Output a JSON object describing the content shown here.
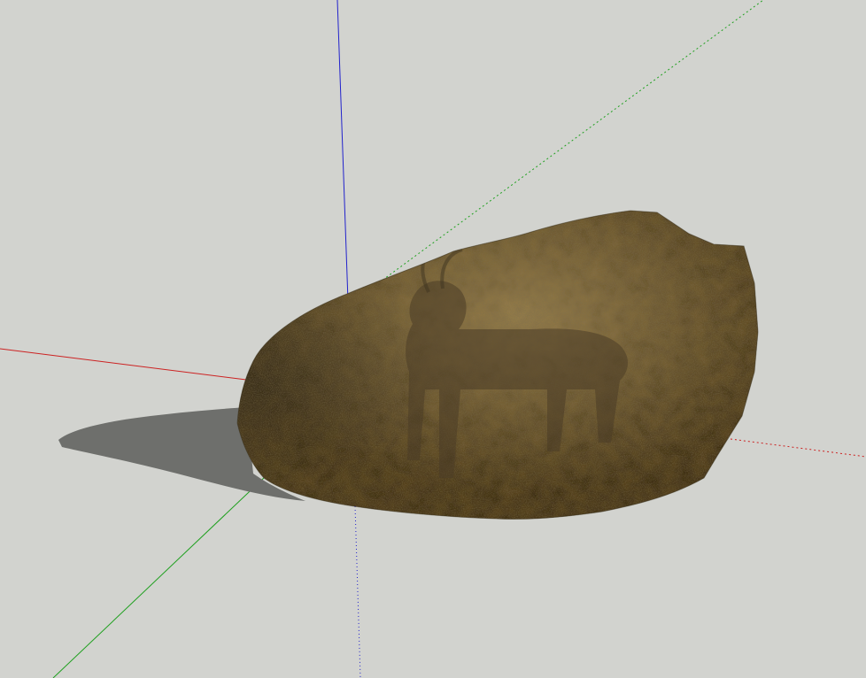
{
  "viewport": {
    "background": "#d2d3cf"
  },
  "axes": {
    "red_axis_color": "#cc2222",
    "green_axis_color": "#1fa01f",
    "blue_axis_color": "#2222cc"
  },
  "model": {
    "icon": "rock-boulder",
    "texture_base_color": "#6b5a38",
    "texture_highlight_color": "#b59a61",
    "texture_shadow_color": "#3a3021"
  },
  "shadow": {
    "color": "#6e6f6c"
  }
}
